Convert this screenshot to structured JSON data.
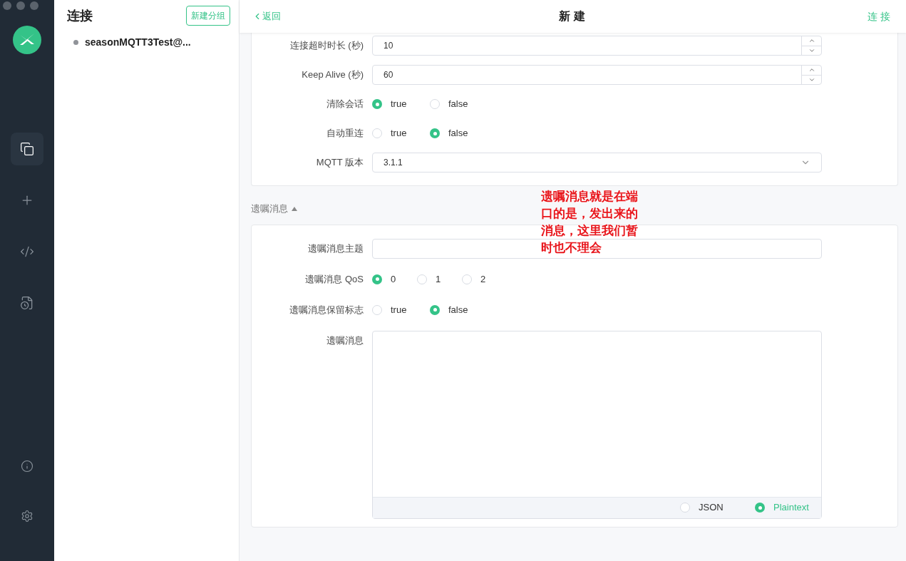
{
  "sidebar": {
    "title": "连接",
    "new_group_button": "新建分组",
    "connections": [
      {
        "name": "seasonMQTT3Test@...",
        "color": "#909399",
        "selected": false
      }
    ],
    "nav": [
      {
        "kind": "connections",
        "selected": true
      },
      {
        "kind": "add",
        "selected": false
      },
      {
        "kind": "script",
        "selected": false
      },
      {
        "kind": "log",
        "selected": false
      }
    ],
    "bottom_nav": [
      {
        "kind": "about"
      },
      {
        "kind": "settings"
      }
    ]
  },
  "header": {
    "back": "返回",
    "title": "新建",
    "action": "连接"
  },
  "settings": {
    "rows": [
      {
        "kind": "number",
        "label": "连接超时时长 (秒)",
        "value": "10"
      },
      {
        "kind": "number",
        "label": "Keep Alive (秒)",
        "value": "60"
      },
      {
        "kind": "radio",
        "label": "清除会话",
        "options": [
          {
            "label": "true",
            "selected": true
          },
          {
            "label": "false",
            "selected": false
          }
        ]
      },
      {
        "kind": "radio",
        "label": "自动重连",
        "options": [
          {
            "label": "true",
            "selected": false
          },
          {
            "label": "false",
            "selected": true
          }
        ]
      },
      {
        "kind": "select",
        "label": "MQTT 版本",
        "value": "3.1.1"
      }
    ]
  },
  "will": {
    "title": "遗嘱消息",
    "expanded": true,
    "rows": [
      {
        "kind": "text",
        "label": "遗嘱消息主题"
      },
      {
        "kind": "radio",
        "label": "遗嘱消息 QoS",
        "options": [
          {
            "label": "0",
            "selected": true
          },
          {
            "label": "1",
            "selected": false
          },
          {
            "label": "2",
            "selected": false
          }
        ]
      },
      {
        "kind": "radio",
        "label": "遗嘱消息保留标志",
        "options": [
          {
            "label": "true",
            "selected": false
          },
          {
            "label": "false",
            "selected": true
          }
        ]
      },
      {
        "kind": "textarea",
        "label": "遗嘱消息",
        "formats": [
          {
            "label": "JSON",
            "selected": false
          },
          {
            "label": "Plaintext",
            "selected": true
          }
        ]
      }
    ]
  },
  "annotation": {
    "text": "遗嘱消息就是在端口的是，发出来的消息，这里我们暂时也不理会"
  }
}
